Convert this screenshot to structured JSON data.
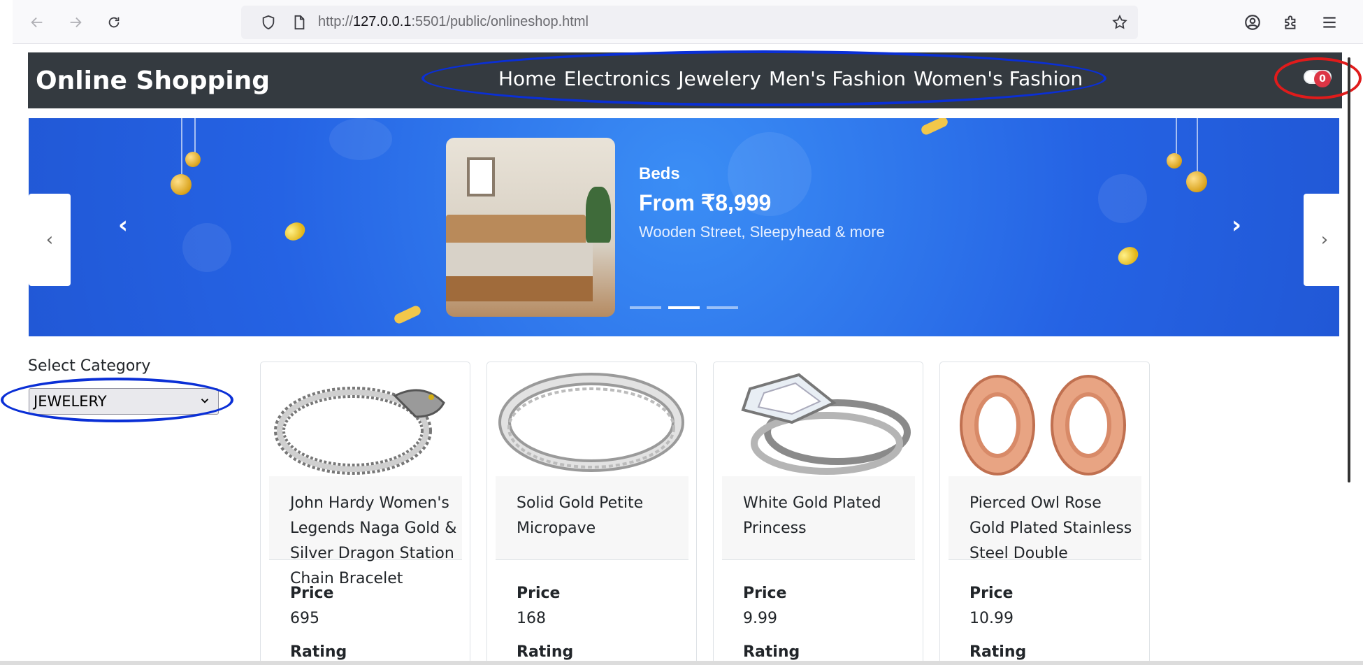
{
  "browser": {
    "url_prefix": "http://",
    "url_host": "127.0.0.1",
    "url_rest": ":5501/public/onlineshop.html"
  },
  "header": {
    "brand": "Online Shopping",
    "nav": [
      "Home",
      "Electronics",
      "Jewelery",
      "Men's Fashion",
      "Women's Fashion"
    ],
    "cart_count": "0"
  },
  "carousel": {
    "category": "Beds",
    "title": "From ₹8,999",
    "subtitle": "Wooden Street, Sleepyhead & more",
    "prev_icon": "chevron-left-icon",
    "next_icon": "chevron-right-icon",
    "slides": 3,
    "active_slide": 2
  },
  "filter": {
    "label": "Select Category",
    "selected": "JEWELERY"
  },
  "products": [
    {
      "name": "John Hardy Women's Legends Naga Gold & Silver Dragon Station Chain Bracelet",
      "price_label": "Price",
      "price": "695",
      "rating_label": "Rating",
      "image": "bracelet"
    },
    {
      "name": "Solid Gold Petite Micropave",
      "price_label": "Price",
      "price": "168",
      "rating_label": "Rating",
      "image": "ring"
    },
    {
      "name": "White Gold Plated Princess",
      "price_label": "Price",
      "price": "9.99",
      "rating_label": "Rating",
      "image": "engagement-ring"
    },
    {
      "name": "Pierced Owl Rose Gold Plated Stainless Steel Double",
      "price_label": "Price",
      "price": "10.99",
      "rating_label": "Rating",
      "image": "plugs"
    }
  ],
  "colors": {
    "header_bg": "#343a40",
    "carousel_bg": "#2563e4",
    "annotation_blue": "#0a2fd6",
    "annotation_red": "#e01b1b",
    "badge": "#dc3545"
  }
}
